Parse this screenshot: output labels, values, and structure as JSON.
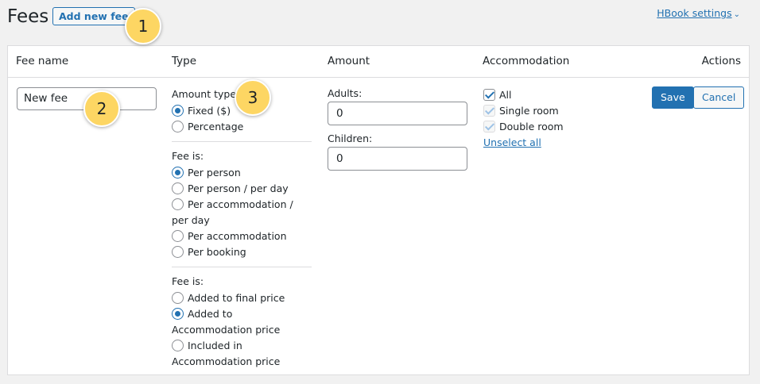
{
  "header": {
    "title": "Fees",
    "add_new_label": "Add new fee",
    "settings_label": "HBook settings"
  },
  "table": {
    "columns": [
      "Fee name",
      "Type",
      "Amount",
      "Accommodation",
      "Actions"
    ]
  },
  "row": {
    "fee_name_value": "New fee",
    "type": {
      "amount_type_label": "Amount type:",
      "amount_type_options": [
        {
          "label": "Fixed ($)",
          "selected": true
        },
        {
          "label": "Percentage",
          "selected": false
        }
      ],
      "fee_is_label": "Fee is:",
      "fee_is_options": [
        {
          "label": "Per person",
          "selected": true
        },
        {
          "label": "Per person / per day",
          "selected": false
        },
        {
          "label": "Per accommodation / per day",
          "selected": false
        },
        {
          "label": "Per accommodation",
          "selected": false
        },
        {
          "label": "Per booking",
          "selected": false
        }
      ],
      "fee_is_label_2": "Fee is:",
      "applied_options": [
        {
          "label": "Added to final price",
          "selected": false
        },
        {
          "label": "Added to Accommodation price",
          "selected": true
        },
        {
          "label": "Included in Accommodation price",
          "selected": false
        }
      ]
    },
    "amount": {
      "adults_label": "Adults:",
      "adults_value": "0",
      "children_label": "Children:",
      "children_value": "0"
    },
    "accommodation": {
      "items": [
        {
          "label": "All",
          "checked": true
        },
        {
          "label": "Single room",
          "checked": true
        },
        {
          "label": "Double room",
          "checked": true
        }
      ],
      "unselect_label": "Unselect all"
    },
    "actions": {
      "save_label": "Save",
      "cancel_label": "Cancel"
    }
  },
  "callouts": [
    "1",
    "2",
    "3"
  ],
  "colors": {
    "accent": "#2271b1",
    "callout": "#fdd663",
    "background": "#f1f1f1"
  }
}
